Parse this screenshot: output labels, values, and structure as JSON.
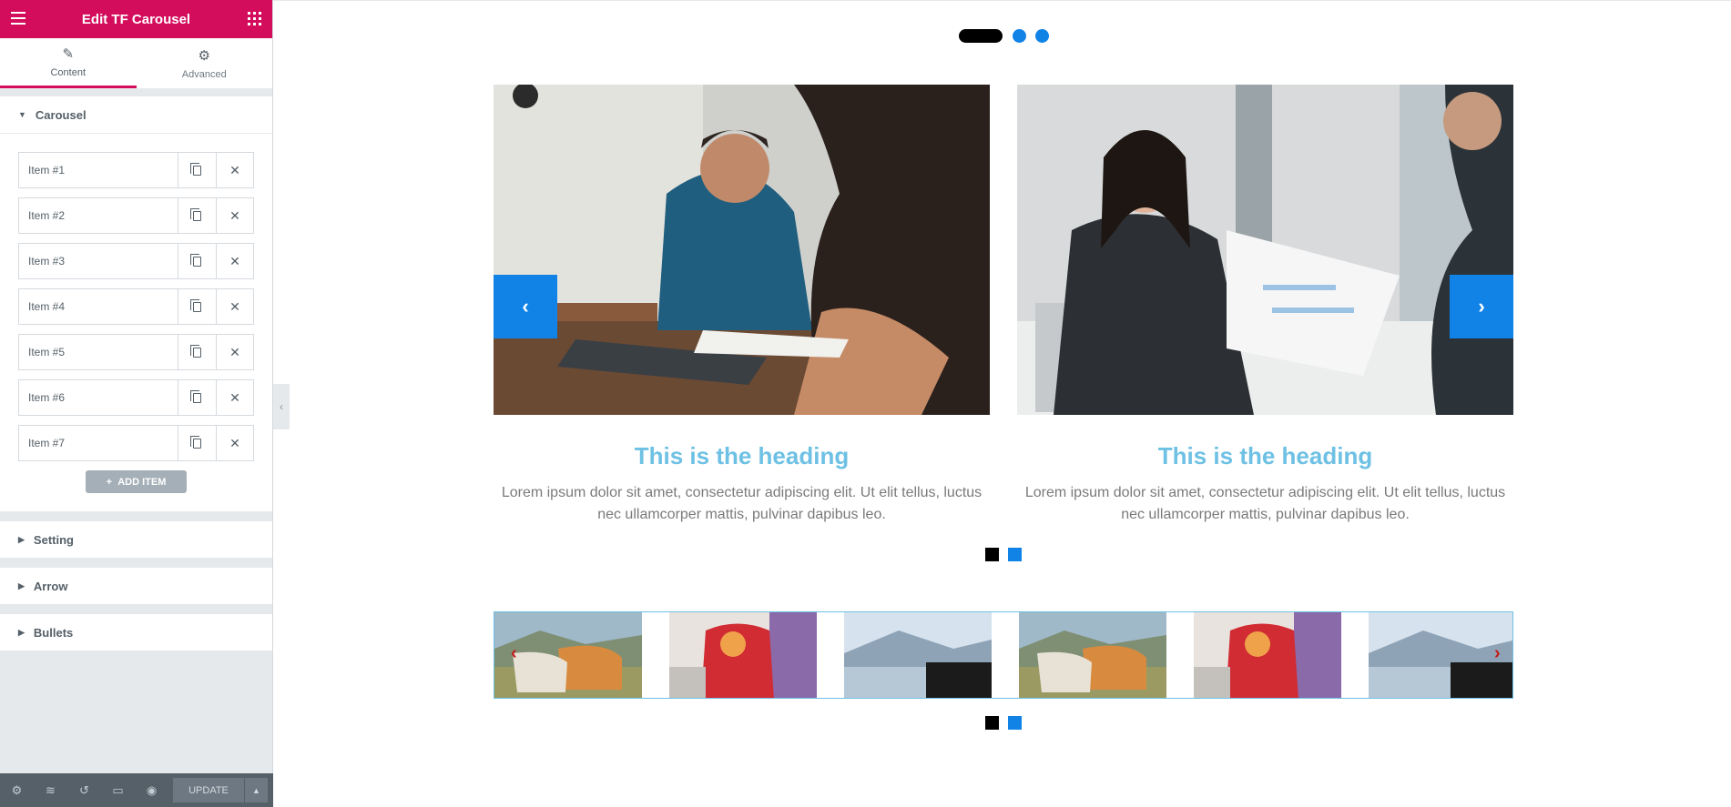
{
  "panel": {
    "title": "Edit TF Carousel",
    "tabs": [
      {
        "label": "Content",
        "icon": "pencil-icon"
      },
      {
        "label": "Advanced",
        "icon": "gear-icon"
      }
    ],
    "sections": {
      "carousel": "Carousel",
      "setting": "Setting",
      "arrow": "Arrow",
      "bullets": "Bullets"
    },
    "items": [
      "Item #1",
      "Item #2",
      "Item #3",
      "Item #4",
      "Item #5",
      "Item #6",
      "Item #7"
    ],
    "add_item_label": "ADD ITEM",
    "footer": {
      "update_label": "UPDATE"
    }
  },
  "preview": {
    "slides": [
      {
        "heading": "This is the heading",
        "text": "Lorem ipsum dolor sit amet, consectetur adipiscing elit. Ut elit tellus, luctus nec ullamcorper mattis, pulvinar dapibus leo."
      },
      {
        "heading": "This is the heading",
        "text": "Lorem ipsum dolor sit amet, consectetur adipiscing elit. Ut elit tellus, luctus nec ullamcorper mattis, pulvinar dapibus leo."
      }
    ],
    "colors": {
      "accent": "#1183e7",
      "heading": "#6ec1e4",
      "brand": "#d30c5c"
    }
  }
}
